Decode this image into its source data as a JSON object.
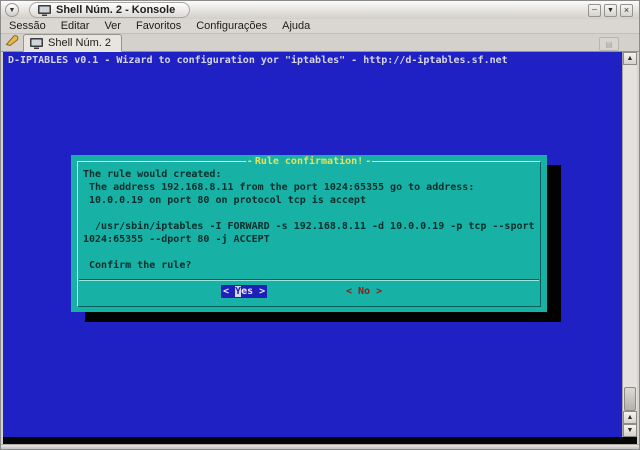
{
  "window": {
    "title": "Shell Núm. 2 - Konsole"
  },
  "icons": {
    "window_menu": "▼",
    "minimize": "─",
    "shade": "▼",
    "close": "×",
    "scroll_up": "▲",
    "scroll_down": "▼",
    "tab_list": "▤"
  },
  "menubar": {
    "items": [
      "Sessão",
      "Editar",
      "Ver",
      "Favoritos",
      "Configurações",
      "Ajuda"
    ]
  },
  "tabbar": {
    "active_tab": "Shell Núm. 2"
  },
  "terminal": {
    "backtitle": "D-IPTABLES v0.1 - Wizard to configuration yor \"iptables\" - http://d-iptables.sf.net"
  },
  "dialog": {
    "title": "Rule confirmation!",
    "title_dash": "-",
    "lines": [
      "The rule would created:",
      " The address 192.168.8.11 from the port 1024:65355 go to address:",
      " 10.0.0.19 on port 80 on protocol tcp is accept",
      "",
      "  /usr/sbin/iptables -I FORWARD -s 192.168.8.11 -d 10.0.0.19 -p tcp --sport",
      "1024:65355 --dport 80 -j ACCEPT",
      "",
      " Confirm the rule?"
    ],
    "buttons": {
      "yes_pre": "< ",
      "yes_hotkey": "Y",
      "yes_rest": "es >",
      "no_label": "< No >"
    }
  },
  "colors": {
    "terminal_bg": "#2021c4",
    "backtitle_text": "#d6d6e6",
    "dialog_bg": "#18b1a6",
    "dialog_title": "#e2e25e",
    "dialog_text": "#072e2b",
    "yes_button_bg": "#1f20bb",
    "no_button_text": "#8c1d12",
    "shadow": "#020202"
  }
}
